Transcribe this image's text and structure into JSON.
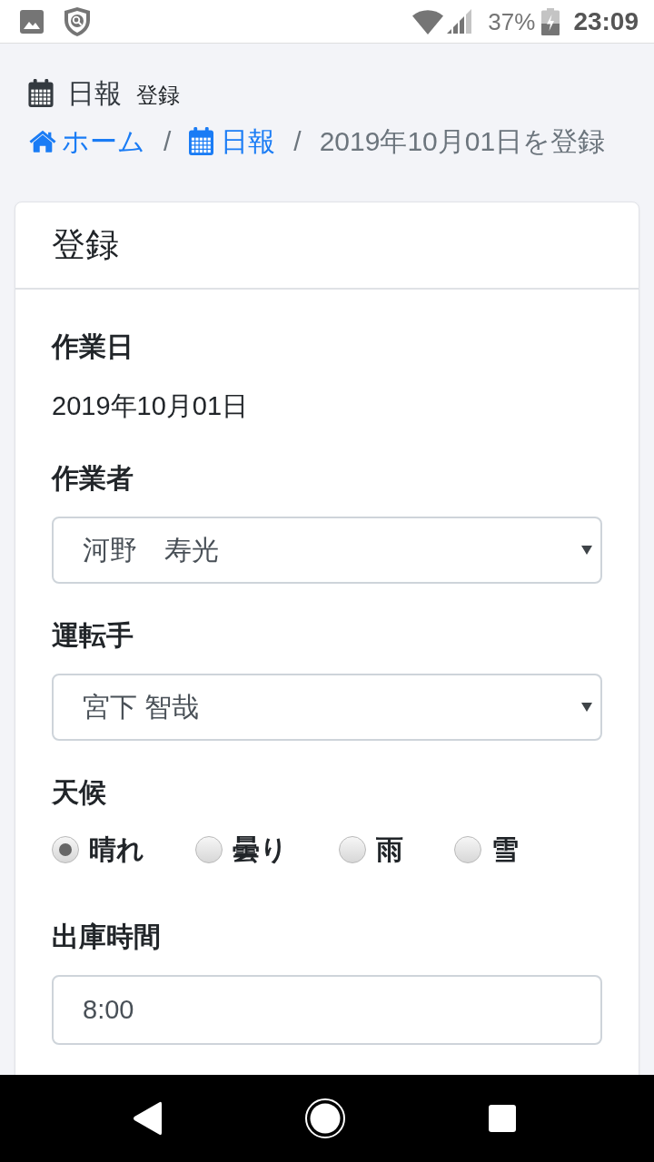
{
  "status_bar": {
    "battery": "37%",
    "time": "23:09"
  },
  "header": {
    "title": "日報",
    "subtitle": "登録"
  },
  "breadcrumb": [
    {
      "kind": "home",
      "label": "ホーム"
    },
    {
      "kind": "separator",
      "label": "/"
    },
    {
      "kind": "link",
      "label": "日報"
    },
    {
      "kind": "separator",
      "label": "/"
    },
    {
      "kind": "current",
      "label": "2019年10月01日を登録"
    }
  ],
  "card": {
    "title": "登録",
    "fields": [
      {
        "kind": "static",
        "label": "作業日",
        "value": "2019年10月01日"
      },
      {
        "kind": "select",
        "label": "作業者",
        "value": "河野　寿光"
      },
      {
        "kind": "select",
        "label": "運転手",
        "value": "宮下 智哉"
      },
      {
        "kind": "radio",
        "label": "天候",
        "options": [
          {
            "label": "晴れ",
            "selected": true
          },
          {
            "label": "曇り",
            "selected": false
          },
          {
            "label": "雨",
            "selected": false
          },
          {
            "label": "雪",
            "selected": false
          }
        ]
      },
      {
        "kind": "input",
        "label": "出庫時間",
        "value": "8:00"
      }
    ]
  }
}
